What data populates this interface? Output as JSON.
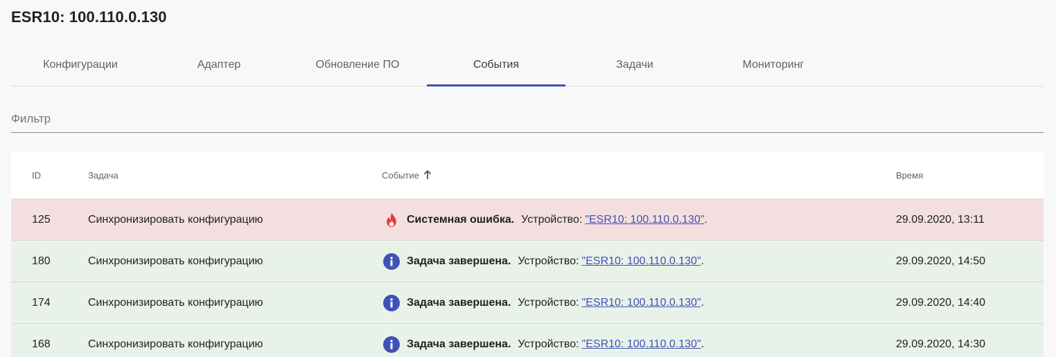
{
  "header": {
    "title": "ESR10: 100.110.0.130"
  },
  "tabs": [
    {
      "label": "Конфигурации",
      "active": false
    },
    {
      "label": "Адаптер",
      "active": false
    },
    {
      "label": "Обновление ПО",
      "active": false
    },
    {
      "label": "События",
      "active": true
    },
    {
      "label": "Задачи",
      "active": false
    },
    {
      "label": "Мониторинг",
      "active": false
    }
  ],
  "filter": {
    "placeholder": "Фильтр",
    "value": ""
  },
  "table": {
    "columns": {
      "id": "ID",
      "task": "Задача",
      "event": "Событие",
      "time": "Время"
    },
    "sort": {
      "column": "event",
      "direction": "asc",
      "icon": "arrow-up-icon"
    },
    "rows": [
      {
        "id": "125",
        "task": "Синхронизировать конфигурацию",
        "type": "error",
        "icon": "fire-icon",
        "event_title": "Системная ошибка.",
        "event_prefix": "Устройство:",
        "event_link": "\"ESR10: 100.110.0.130\"",
        "event_suffix": ".",
        "time": "29.09.2020, 13:11"
      },
      {
        "id": "180",
        "task": "Синхронизировать конфигурацию",
        "type": "info",
        "icon": "info-icon",
        "event_title": "Задача завершена.",
        "event_prefix": "Устройство:",
        "event_link": "\"ESR10: 100.110.0.130\"",
        "event_suffix": ".",
        "time": "29.09.2020, 14:50"
      },
      {
        "id": "174",
        "task": "Синхронизировать конфигурацию",
        "type": "info",
        "icon": "info-icon",
        "event_title": "Задача завершена.",
        "event_prefix": "Устройство:",
        "event_link": "\"ESR10: 100.110.0.130\"",
        "event_suffix": ".",
        "time": "29.09.2020, 14:40"
      },
      {
        "id": "168",
        "task": "Синхронизировать конфигурацию",
        "type": "info",
        "icon": "info-icon",
        "event_title": "Задача завершена.",
        "event_prefix": "Устройство:",
        "event_link": "\"ESR10: 100.110.0.130\"",
        "event_suffix": ".",
        "time": "29.09.2020, 14:30"
      }
    ]
  },
  "colors": {
    "accent": "#3f51b5",
    "error_row": "#f4dfe0",
    "info_row": "#e8f2e8",
    "error_icon": "#e53935",
    "info_icon": "#3f51b5"
  }
}
